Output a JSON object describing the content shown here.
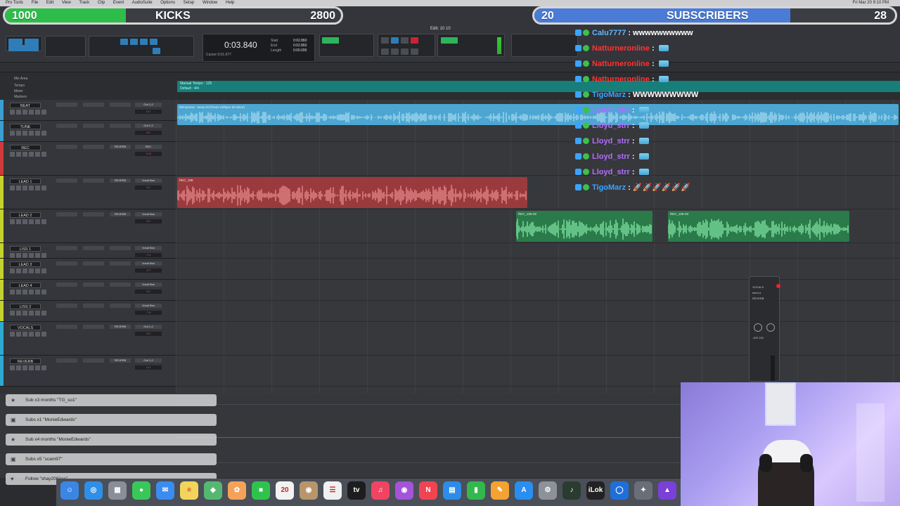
{
  "menubar": {
    "items": [
      "Pro Tools",
      "File",
      "Edit",
      "View",
      "Track",
      "Clip",
      "Event",
      "AudioSuite",
      "Options",
      "Setup",
      "Window",
      "Help"
    ],
    "clock": "Fri Mar 20  9:10 PM"
  },
  "window": {
    "title": "Edit: 10 10"
  },
  "goals": {
    "kicks": {
      "left": "1000",
      "label": "KICKS",
      "right": "2800",
      "color": "#2ebd4a",
      "progress": 0.36
    },
    "subs": {
      "left": "20",
      "label": "SUBSCRIBERS",
      "right": "28",
      "color": "#4a7bd6",
      "progress": 0.71
    }
  },
  "counter": {
    "main": "0:03.840",
    "sub": "Cursor        0:01.677",
    "start_label": "Start",
    "end_label": "End",
    "length_label": "Length",
    "start": "0:02.860",
    "end": "0:02.860",
    "length": "0:00.000"
  },
  "rulers": {
    "tempo": "Manual Tempo : 125",
    "default": "Default : 4/4"
  },
  "tracks": [
    {
      "name": "BEAT",
      "color": "#3a9fd0",
      "insert1": "",
      "io": "Out 1-2",
      "vol": "0.0",
      "height": 30
    },
    {
      "name": "TUNE",
      "color": "#3a9fd0",
      "insert1": "",
      "io": "Out 1-2",
      "vol": "0.0",
      "height": 30
    },
    {
      "name": "REC",
      "color": "#d03a3a",
      "insert1": "REVERB",
      "io": "REC",
      "vol": "+3.5",
      "height": 48
    },
    {
      "name": "LEAD 1",
      "color": "#c5d12e",
      "insert1": "REVERB",
      "io": "Vocal Bus",
      "vol": "0.0",
      "height": 48
    },
    {
      "name": "LEAD 2",
      "color": "#c5d12e",
      "insert1": "REVERB",
      "io": "Vocal Bus",
      "vol": "0.0",
      "height": 48
    },
    {
      "name": "LISS 1",
      "color": "#c5d12e",
      "insert1": "",
      "io": "Vocal Bus",
      "vol": "-7.2",
      "height": 22
    },
    {
      "name": "LEAD 3",
      "color": "#c5d12e",
      "insert1": "",
      "io": "Vocal Bus",
      "vol": "-3.7",
      "height": 30
    },
    {
      "name": "LEAD 4",
      "color": "#c5d12e",
      "insert1": "",
      "io": "Vocal Bus",
      "vol": "0.0",
      "height": 30
    },
    {
      "name": "LISS 2",
      "color": "#c5d12e",
      "insert1": "",
      "io": "Vocal Bus",
      "vol": "-7.6",
      "height": 30
    },
    {
      "name": "VOCALS",
      "color": "#2eaad0",
      "insert1": "REVERB",
      "io": "Out 1-2",
      "vol": "0.0",
      "height": 48
    },
    {
      "name": "REVERB",
      "color": "#2eaad0",
      "insert1": "REVERB",
      "io": "Out 1-2",
      "vol": "0.0",
      "height": 44
    }
  ],
  "clips": [
    {
      "name": "Blimpdown - Deep Drill beat 140bpm (B Minor)",
      "color": "#4ca6d1",
      "wave": "#9fd6ee"
    },
    {
      "name": "REC_106",
      "color": "#9b3a3d",
      "wave": "#e4888b"
    },
    {
      "name": "REC_106-02",
      "color": "#2a7a4a",
      "wave": "#7ee0a0"
    },
    {
      "name": "REC_106-03",
      "color": "#2a7a4a",
      "wave": "#7ee0a0"
    }
  ],
  "mini_fader": {
    "name": "VOCALS",
    "send": "send a",
    "target": "REVERB",
    "values": "-100   100"
  },
  "chat": [
    {
      "user": "Calu7777",
      "msg": "wwwwwwwwww",
      "color": "#5fb8ff",
      "emote": false
    },
    {
      "user": "Natturneronline",
      "msg": "",
      "color": "#ff3535",
      "emote": true
    },
    {
      "user": "Natturneronline",
      "msg": "",
      "color": "#ff3535",
      "emote": true
    },
    {
      "user": "Natturneronline",
      "msg": "",
      "color": "#ff3535",
      "emote": true
    },
    {
      "user": "TigoMarz",
      "msg": "WWWWWWWWW",
      "color": "#3aa4ff",
      "emote": false
    },
    {
      "user": "Lloyd_strr",
      "msg": "",
      "color": "#b46cff",
      "emote": true
    },
    {
      "user": "Lloyd_strr",
      "msg": "",
      "color": "#b46cff",
      "emote": true
    },
    {
      "user": "Lloyd_strr",
      "msg": "",
      "color": "#b46cff",
      "emote": true
    },
    {
      "user": "Lloyd_strr",
      "msg": "",
      "color": "#b46cff",
      "emote": true
    },
    {
      "user": "Lloyd_strr",
      "msg": "",
      "color": "#b46cff",
      "emote": true
    },
    {
      "user": "TigoMarz",
      "msg": "🚀🚀🚀🚀🚀🚀",
      "color": "#3aa4ff",
      "emote": false
    }
  ],
  "alerts": [
    {
      "text": "Sub x3 months \"TG_so1\"",
      "icon": "star"
    },
    {
      "text": "Subs x1 \"MonieEdwards\"",
      "icon": "gift"
    },
    {
      "text": "Sub x4 months \"MonieEdwards\"",
      "icon": "star"
    },
    {
      "text": "Subs x5 \"scam97\"",
      "icon": "gift"
    },
    {
      "text": "Follow \"shay2001cc\"",
      "icon": "heart"
    }
  ],
  "dock": [
    {
      "name": "finder",
      "color": "#3b86e4",
      "glyph": "☺"
    },
    {
      "name": "safari",
      "color": "#2f8fe6",
      "glyph": "◎"
    },
    {
      "name": "launchpad",
      "color": "#8a8e98",
      "glyph": "▦"
    },
    {
      "name": "messages",
      "color": "#3ac75a",
      "glyph": "●"
    },
    {
      "name": "mail",
      "color": "#3b8cf0",
      "glyph": "✉"
    },
    {
      "name": "notes",
      "color": "#f2d45c",
      "glyph": "≡"
    },
    {
      "name": "maps",
      "color": "#56b870",
      "glyph": "◆"
    },
    {
      "name": "photos",
      "color": "#f4a25a",
      "glyph": "✿"
    },
    {
      "name": "facetime",
      "color": "#2fc34d",
      "glyph": "■"
    },
    {
      "name": "calendar",
      "color": "#f2f2f2",
      "glyph": "20"
    },
    {
      "name": "contacts",
      "color": "#b8956a",
      "glyph": "◉"
    },
    {
      "name": "reminders",
      "color": "#f0f0f0",
      "glyph": "☰"
    },
    {
      "name": "tv",
      "color": "#1d1d1f",
      "glyph": "tv"
    },
    {
      "name": "music",
      "color": "#f04462",
      "glyph": "♫"
    },
    {
      "name": "podcasts",
      "color": "#a454d8",
      "glyph": "◉"
    },
    {
      "name": "news",
      "color": "#f04452",
      "glyph": "N"
    },
    {
      "name": "keynote",
      "color": "#2d8ce8",
      "glyph": "▤"
    },
    {
      "name": "numbers",
      "color": "#34b84e",
      "glyph": "▮"
    },
    {
      "name": "pages",
      "color": "#f4a233",
      "glyph": "✎"
    },
    {
      "name": "app-store",
      "color": "#2a8ef0",
      "glyph": "A"
    },
    {
      "name": "system-settings",
      "color": "#8e9198",
      "glyph": "⚙"
    },
    {
      "name": "sound-app",
      "color": "#2a3c30",
      "glyph": "♪"
    },
    {
      "name": "ilok",
      "color": "#222",
      "glyph": "iLok"
    },
    {
      "name": "circle-app",
      "color": "#1f6fd8",
      "glyph": "◯"
    },
    {
      "name": "utility",
      "color": "#6a6e78",
      "glyph": "✦"
    },
    {
      "name": "pro-tools",
      "color": "#7a40d8",
      "glyph": "▲"
    }
  ],
  "calendar_badge": "20"
}
